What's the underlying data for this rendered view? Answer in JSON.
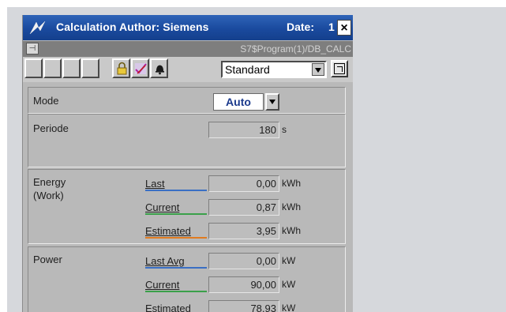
{
  "window": {
    "title": "Calculation Author: Siemens",
    "date_label": "Date:",
    "date_value": "1",
    "close_glyph": "×",
    "path": "S7$Program(1)/DB_CALC",
    "pin_glyph": "⊣"
  },
  "toolbar": {
    "view_select": "Standard"
  },
  "mode": {
    "label": "Mode",
    "value": "Auto"
  },
  "periode": {
    "label": "Periode",
    "value": "180",
    "unit": "s"
  },
  "energy": {
    "label_line1": "Energy",
    "label_line2": "(Work)",
    "rows": [
      {
        "name": "Last",
        "value": "0,00",
        "unit": "kWh",
        "color": "#3a6fc4"
      },
      {
        "name": "Current",
        "value": "0,87",
        "unit": "kWh",
        "color": "#3aa04a"
      },
      {
        "name": "Estimated",
        "value": "3,95",
        "unit": "kWh",
        "color": "#e07b20"
      }
    ]
  },
  "power": {
    "label": "Power",
    "rows": [
      {
        "name": "Last Avg",
        "value": "0,00",
        "unit": "kW",
        "color": "#3a6fc4"
      },
      {
        "name": "Current",
        "value": "90,00",
        "unit": "kW",
        "color": "#3aa04a"
      },
      {
        "name": "Estimated",
        "value": "78,93",
        "unit": "kW",
        "color": "#e07b20"
      }
    ]
  },
  "icons": [
    "siemens-logo-icon",
    "close-icon",
    "pin-icon",
    "lock-icon",
    "pen-check-icon",
    "bell-icon",
    "resize-icon",
    "dropdown-arrow-icon"
  ]
}
